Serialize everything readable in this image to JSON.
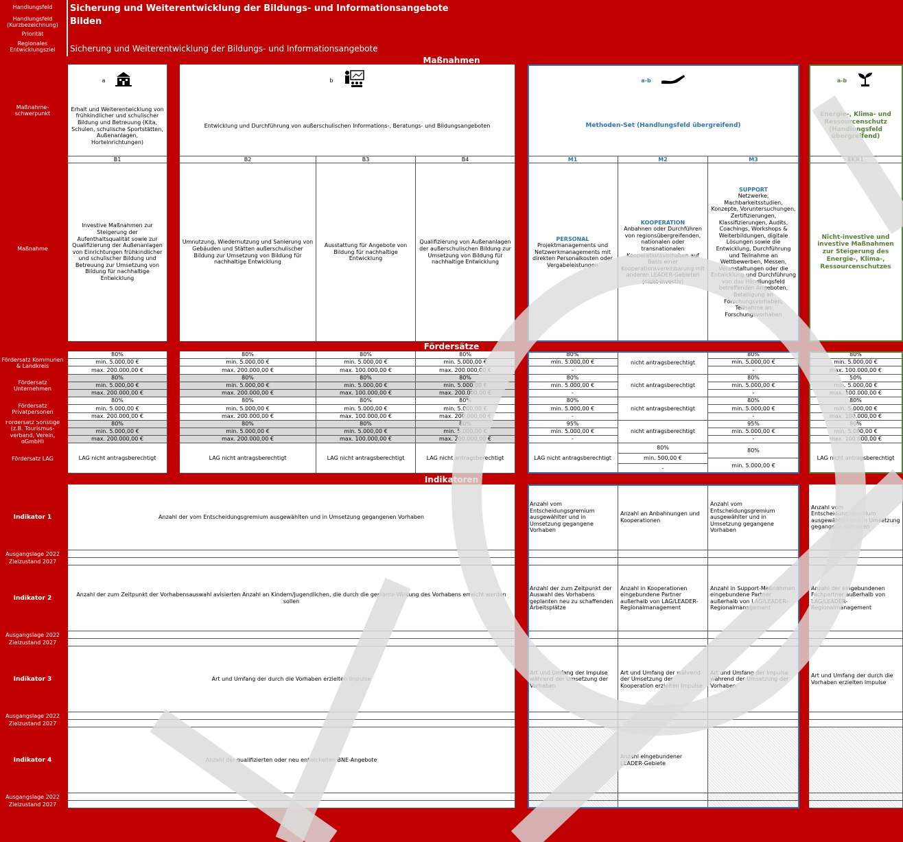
{
  "header": {
    "lbl_hf": "Handlungsfeld",
    "lbl_hf_kurz": "Handlungsfeld (Kurzbezeichnung)",
    "lbl_prio": "Priorität",
    "lbl_rez": "Regionales Entwicklungsziel",
    "hf_title": "Sicherung und Weiterentwicklung der Bildungs- und Informationsangebote",
    "hf_kurz": "Bilden",
    "rez_text": "Sicherung und Weiterentwicklung der Bildungs- und Informationsangebote"
  },
  "bands": {
    "massnahmen": "Maßnahmen",
    "foerdersaetze": "Fördersätze",
    "indikatoren": "Indikatoren"
  },
  "row_labels": {
    "schwerpunkt": "Maßnahme-schwerpunkt",
    "massnahme": "Maßnahme",
    "fs_kommunen": "Fördersatz Kommunen & Landkreis",
    "fs_unternehmen": "Fördersatz Unternehmen",
    "fs_privat": "Fördersatz Privatpersonen",
    "fs_sonstige": "Fördersatz Sonstige (z.B. Tourismus-verband, Verein, gGmbH)",
    "fs_lag": "Fördersatz LAG",
    "ind1": "Indikator 1",
    "ind2": "Indikator 2",
    "ind3": "Indikator 3",
    "ind4": "Indikator 4",
    "ausgang": "Ausgangslage 2022",
    "ziel": "Zielzustand 2027"
  },
  "schwerpunkte": {
    "a_letter": "a",
    "b_letter": "b",
    "ab_letter": "a-b",
    "ab2_letter": "a-b",
    "a_text": "Erhalt und Weiterentwicklung von frühkindlicher und schulischer Bildung und Betreuung (Kita, Schulen, schulische Sportstätten, Außenanlagen, Horteinrichtungen)",
    "b_text": "Entwicklung und Durchführung von außerschulischen Informations-, Beratungs- und Bildungsangeboten",
    "m_text": "Methoden-Set (Handlungsfeld übergreifend)",
    "e_text": "Energie-, Klima- und Ressourcenschutz (Handlungsfeld übergreifend)"
  },
  "codes": {
    "B1": "B1",
    "B2": "B2",
    "B3": "B3",
    "B4": "B4",
    "M1": "M1",
    "M2": "M2",
    "M3": "M3",
    "EKR1": "EKR1"
  },
  "massnahmen": {
    "B1": "Investive Maßnahmen zur Steigerung der Aufenthaltsqualität sowie zur Qualifizierung der Außenanlagen von Einrichtungen frühkindlicher und schulischer Bildung und Betreuung zur Umsetzung von Bildung für nachhaltige Entwicklung",
    "B2": "Umnutzung, Wiedernutzung und Sanierung von Gebäuden und Stätten außerschulischer Bildung zur Umsetzung von Bildung für nachhaltige Entwicklung",
    "B3": "Ausstattung für Angebote von Bildung für nachhaltige Entwicklung",
    "B4": "Qualifizierung von Außenanlagen der außerschulischen Bildung zur Umsetzung von Bildung für nachhaltige Entwicklung",
    "M1_head": "PERSONAL",
    "M1": "Projektmanagements und Netzwerkmanagements mit direkten Personalkosten oder Vergabeleistungen",
    "M2_head": "KOOPERATION",
    "M2": "Anbahnen oder Durchführen von regionsübergreifenden, nationalen oder transnationalen Kooperationsvorhaben auf Basis einer Kooperationsvereinbarung mit anderen LEADER-Gebieten (nicht-investiv)",
    "M3_head": "SUPPORT",
    "M3": "Netzwerke, Machbarkeitsstudien, Konzepte, Voruntersuchungen, Zertifizierungen, Klassifizierungen, Audits, Coachings, Workshops & Weiterbildungen, digitale Lösungen sowie die Entwicklung, Durchführung und Teilnahme an Wettbewerben, Messen, Veranstaltungen oder die Entwicklung und Durchführung von das Handlungsfeld betreffenden Angeboten, Beteiligung an Forschungsvorhaben, Teilnahme an Forschungsvorhaben",
    "EKR1": "Nicht-investive und investive Maßnahmen zur Steigerung des Energie-, Klima-, Ressourcenschutzes"
  },
  "foerder": {
    "p80": "80%",
    "p50": "50%",
    "p95": "95%",
    "min5000": "min. 5.000,00 €",
    "min500": "min. 500,00 €",
    "max200": "max. 200.000,00 €",
    "max100": "max. 100.000,00 €",
    "dash": "-",
    "nicht": "nicht antragsberechtigt",
    "lag_nicht": "LAG nicht antragsberechtigt"
  },
  "indikatoren": {
    "ind1_B": "Anzahl der vom Entscheidungsgremium ausgewählten und in Umsetzung gegangenen Vorhaben",
    "ind1_M1": "Anzahl vom Entscheidungsgremium ausgewählter und in Umsetzung gegangene Vorhaben",
    "ind1_M2": "Anzahl an Anbahnungen und Kooperationen",
    "ind1_M3": "Anzahl vom Entscheidungsgremium ausgewählter und in Umsetzung gegangene Vorhaben",
    "ind1_E": "Anzahl vom Entscheidungsgremium ausgewählter und in Umsetzung gegangene Vorhaben",
    "ind2_B": "Anzahl der zum Zeitpunkt der Vorhabensauswahl avisierten Anzahl an Kindern/Jugendlichen, die durch die geplante Wirkung des Vorhabens erreicht werden sollen",
    "ind2_M1": "Anzahl der zum Zeitpunkt der Auswahl des Vorhabens geplanten neu zu schaffenden Arbeitsplätze",
    "ind2_M2": "Anzahl in Kooperationen eingebundene Partner außerhalb von LAG/LEADER-Regionalmanagement",
    "ind2_M3": "Anzahl in Support-Maßnahmen eingebundene Partner außerhalb von LAG/LEADER-Regionalmanagement",
    "ind2_E": "Anzahl der eingebundenen Fachpartner außerhalb von LAG/LEADER-Regionalmanagement",
    "ind3_B": "Art und Umfang der durch die Vorhaben erzielten Impulse",
    "ind3_M1": "Art und Umfang der Impulse während der Umsetzung der Vorhaben",
    "ind3_M2": "Art und Umfang der während der Umsetzung der Kooperation erzielten Impulse",
    "ind3_M3": "Art und Umfang der Impulse während der Umsetzung der Vorhaben",
    "ind3_E": "Art und Umfang der durch die Vorhaben erzielten Impulse",
    "ind4_B": "Anzahl der qualifizierten oder neu entwickelten BNE-Angebote",
    "ind4_M2": "Anzahl eingebundener LEADER-Gebiete"
  },
  "icons": {
    "a": "school-icon",
    "b": "teacher-icon",
    "ab": "hand-icon",
    "e": "plant-icon"
  },
  "colors": {
    "red": "#c00000",
    "blue": "#2e75b6",
    "green": "#538135",
    "grey": "#d9d9d9"
  }
}
